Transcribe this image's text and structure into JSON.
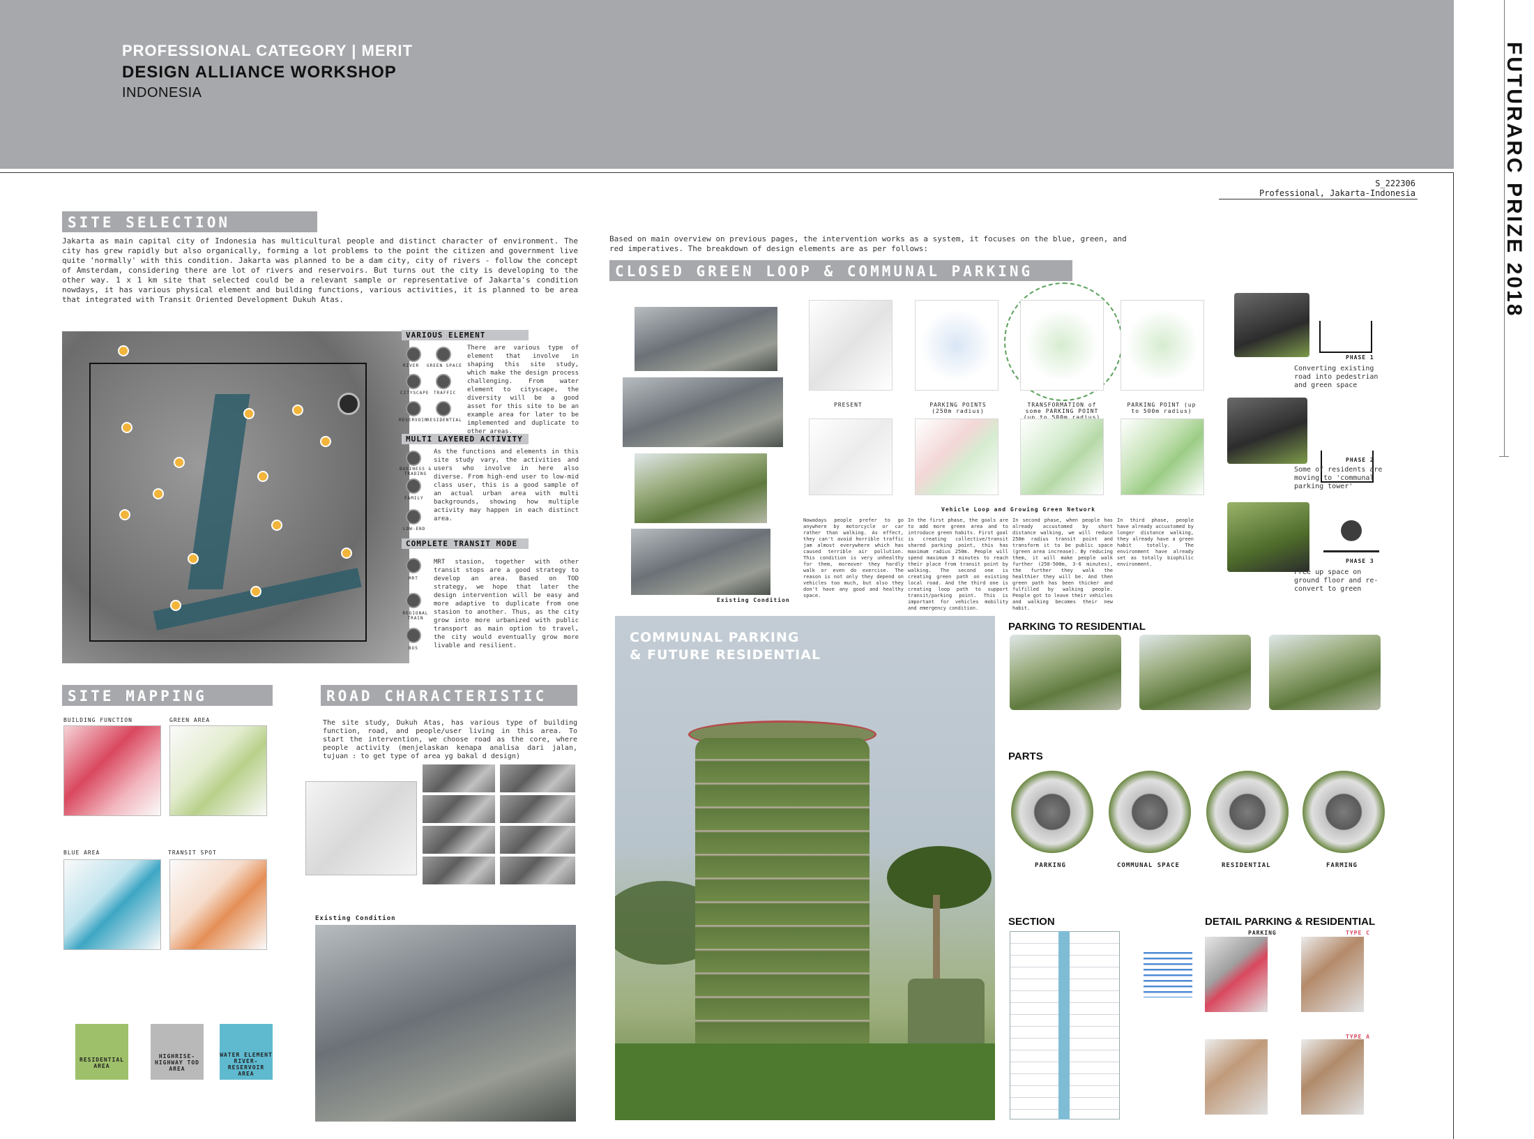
{
  "header": {
    "category": "PROFESSIONAL CATEGORY | MERIT",
    "firm": "DESIGN ALLIANCE WORKSHOP",
    "country": "INDONESIA"
  },
  "side_title": "FUTURARC PRIZE 2018",
  "submission": {
    "id": "S_222306",
    "label": "Professional, Jakarta-Indonesia"
  },
  "site_selection": {
    "heading": "SITE SELECTION",
    "text": "Jakarta as main capital city of Indonesia has multicultural people and distinct character of environment. The city has grew rapidly but also organically, forming a lot problems to the point the citizen and government live quite 'normally' with this condition. Jakarta was planned to be a dam city, city of rivers - follow the concept of Amsterdam, considering there are lot of rivers and reservoirs. But turns out the city is developing to the other way. 1 x 1 km site that selected could be a relevant sample or representative of Jakarta's condition nowdays, it has various physical element and building functions, various activities, it is planned to be area that integrated with Transit Oriented Development Dukuh Atas."
  },
  "various_element": {
    "heading": "VARIOUS ELEMENT",
    "icons": [
      "RIVER",
      "GREEN SPACE",
      "CITYSCAPE",
      "TRAFFIC",
      "RESERVOIR",
      "RESIDENTIAL"
    ],
    "text": "There are various type of element that involve in shaping this site study, which make the design process challenging. From water element to cityscape, the diversity will be a good asset for this site to be an example area for later to be implemented and duplicate to other areas."
  },
  "multi_layered": {
    "heading": "MULTI LAYERED ACTIVITY",
    "icons": [
      "BUSINESS & TRADING",
      "FAMILY",
      "LOW-END"
    ],
    "text": "As the functions and elements in this site study vary, the activities and users who involve in here also diverse. From high-end user to low-mid class user, this is a good sample of an actual urban area with multi backgrounds, showing how multiple activity may happen in each distinct area."
  },
  "transit_mode": {
    "heading": "COMPLETE TRANSIT MODE",
    "icons": [
      "MRT",
      "REGIONAL TRAIN",
      "BUS"
    ],
    "text": "MRT stasion, together with other transit stops are a good strategy to develop an area. Based on TOD strategy, we hope that later the design intervention will be easy and more adaptive to duplicate from one stasion to another. Thus, as the city grow into more urbanized with public transport as main option to travel, the city would eventually grow more livable and resilient."
  },
  "site_mapping": {
    "heading": "SITE MAPPING",
    "maps": [
      "BUILDING FUNCTION",
      "GREEN AREA",
      "BLUE AREA",
      "TRANSIT SPOT"
    ],
    "areas": [
      "RESIDENTIAL AREA",
      "HIGHRISE-HIGHWAY TOD AREA",
      "WATER ELEMENT RIVER-RESERVOIR AREA"
    ]
  },
  "road_characteristic": {
    "heading": "ROAD CHARACTERISTIC",
    "text": "The site study, Dukuh Atas, has various type of building function, road, and people/user living in this area. To start the intervention, we choose road as the core, where people activity (menjelaskan kenapa analisa dari jalan, tujuan : to get type of area yg bakal d design)",
    "existing_label": "Existing Condition"
  },
  "intro": {
    "text": "Based on main overview on previous pages, the intervention works as a system, it focuses on the blue, green, and red imperatives. The breakdown of design elements are as per follows:"
  },
  "closed_loop": {
    "heading": "CLOSED GREEN LOOP & COMMUNAL PARKING",
    "existing_label": "Existing Condition",
    "map_labels": [
      "PRESENT",
      "PARKING POINTS (250m radius)",
      "TRANSFORMATION of some PARKING POINT (up to 500m radius)",
      "PARKING POINT (up to 500m radius)"
    ],
    "network_label": "Vehicle Loop and Growing Green Network",
    "col1": "Nowadays people prefer to go anywhere by motorcycle or car rather than walking. As effect, they can't avoid horrible traffic jam almost everywhere which has caused terrible air pollution. This condition is very unhealthy for them, moreover they hardly walk or even do exercise. The reason is not only they depend on vehicles too much, but also they don't have any good and healthy space.",
    "col2": "In the first phase, the goals are to add more green area and to introduce green habits. First goal is creating collective/transit shared parking point, this has maximum radius 250m. People will spend maximum 3 minutes to reach their place from transit point by walking. The second one is creating green path on existing local road. And the third one is creating loop path to support transit/parking point. This is important for vehicles mobility and emergency condition.",
    "col3": "In second phase, when people has already accustomed by short distance walking, we will reduce 250m radius transit point and transform it to be public space (green area increase). By reducing them, it will make people walk further (250-500m, 3-6 minutes), the further they walk the healthier they will be. And then green path has been thicker and fulfilled by walking people. People got to leave their vehicles and walking becomes their new habit.",
    "col4": "In third phase, people have already accustomed by longer distance walking, they already have a green habit totally. The environment have already set as totally biophilic environment."
  },
  "phases": [
    {
      "label": "PHASE 1",
      "text": "Converting existing road into pedestrian and green space"
    },
    {
      "label": "PHASE 2",
      "text": "Some of residents are moving to 'communal parking tower'"
    },
    {
      "label": "PHASE 3",
      "text": "Free up space on ground floor and re-convert to green"
    }
  ],
  "render": {
    "title_line1": "COMMUNAL PARKING",
    "title_line2": "& FUTURE RESIDENTIAL"
  },
  "parking_to_residential": {
    "heading": "PARKING TO RESIDENTIAL"
  },
  "parts": {
    "heading": "PARTS",
    "labels": [
      "PARKING",
      "COMMUNAL SPACE",
      "RESIDENTIAL",
      "FARMING"
    ]
  },
  "section": {
    "heading": "SECTION"
  },
  "detail": {
    "heading": "DETAIL PARKING & RESIDENTIAL",
    "labels": [
      "PARKING",
      "TYPE C",
      "TYPE A"
    ]
  },
  "colors": {
    "header_gray": "#a7a8ac",
    "residential_green": "#9fc06a",
    "highrise_gray": "#b9b9b9",
    "water_blue": "#5fbad0",
    "building_red": "#d9485e"
  }
}
